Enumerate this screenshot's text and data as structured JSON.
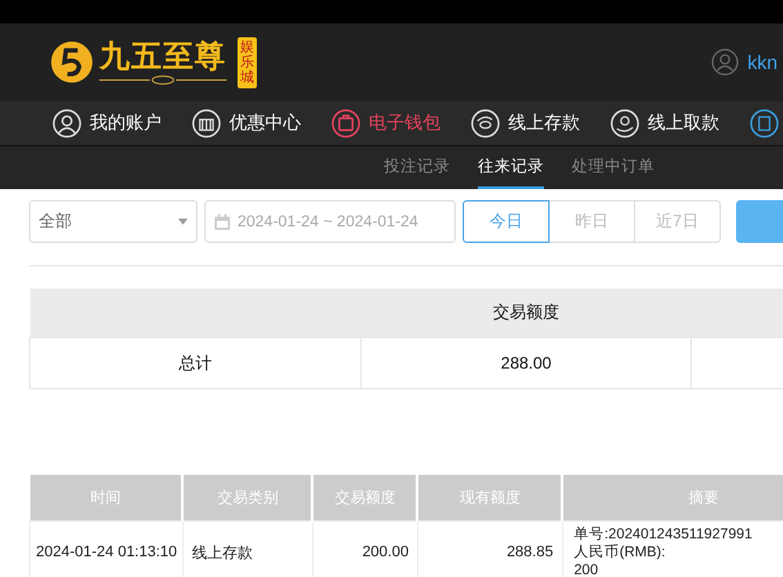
{
  "header": {
    "logo_text": "九五至尊",
    "logo_badge": "娱乐城",
    "username": "kkn"
  },
  "nav": [
    {
      "label": "我的账户",
      "selected": false
    },
    {
      "label": "优惠中心",
      "selected": false
    },
    {
      "label": "电子钱包",
      "selected": true
    },
    {
      "label": "线上存款",
      "selected": false
    },
    {
      "label": "线上取款",
      "selected": false
    }
  ],
  "subtabs": [
    {
      "label": "投注记录",
      "selected": false
    },
    {
      "label": "往来记录",
      "selected": true
    },
    {
      "label": "处理中订单",
      "selected": false
    }
  ],
  "filter": {
    "type_select": "全部",
    "date_range": "2024-01-24 ~ 2024-01-24",
    "quick_dates": [
      {
        "label": "今日",
        "selected": true
      },
      {
        "label": "昨日",
        "selected": false
      },
      {
        "label": "近7日",
        "selected": false
      }
    ]
  },
  "summary": {
    "header": "交易额度",
    "row": [
      "总计",
      "288.00"
    ]
  },
  "records": {
    "columns": [
      "时间",
      "交易类别",
      "交易额度",
      "现有额度",
      "摘要"
    ],
    "rows": [
      {
        "time": "2024-01-24 01:13:10",
        "type": "线上存款",
        "amount": "200.00",
        "balance": "288.85",
        "summary_lines": [
          "单号:202401243511927991",
          "人民币(RMB):",
          "200"
        ]
      }
    ]
  }
}
